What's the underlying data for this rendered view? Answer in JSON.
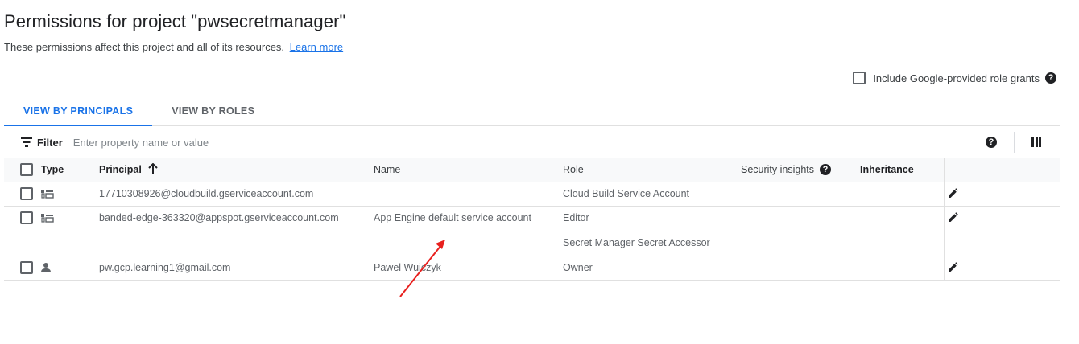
{
  "header": {
    "title": "Permissions for project \"pwsecretmanager\"",
    "subtitle": "These permissions affect this project and all of its resources.",
    "learn_more": "Learn more"
  },
  "include_grants": {
    "label": "Include Google-provided role grants",
    "checked": false
  },
  "tabs": [
    {
      "label": "VIEW BY PRINCIPALS",
      "active": true
    },
    {
      "label": "VIEW BY ROLES",
      "active": false
    }
  ],
  "filter": {
    "label": "Filter",
    "placeholder": "Enter property name or value"
  },
  "table": {
    "columns": {
      "type": "Type",
      "principal": "Principal",
      "name": "Name",
      "role": "Role",
      "security_insights": "Security insights",
      "inheritance": "Inheritance"
    },
    "rows": [
      {
        "type_icon": "service-account-icon",
        "principal": "17710308926@cloudbuild.gserviceaccount.com",
        "name": "",
        "roles": [
          "Cloud Build Service Account"
        ]
      },
      {
        "type_icon": "service-account-icon",
        "principal": "banded-edge-363320@appspot.gserviceaccount.com",
        "name": "App Engine default service account",
        "roles": [
          "Editor",
          "Secret Manager Secret Accessor"
        ]
      },
      {
        "type_icon": "person-icon",
        "principal": "pw.gcp.learning1@gmail.com",
        "name": "Pawel Wujczyk",
        "roles": [
          "Owner"
        ]
      }
    ]
  },
  "annotation": {
    "type": "red-arrow",
    "color": "#e8201e"
  },
  "colors": {
    "accent": "#1a73e8",
    "text": "#202124",
    "muted": "#5f6368",
    "border": "#e0e0e0"
  }
}
